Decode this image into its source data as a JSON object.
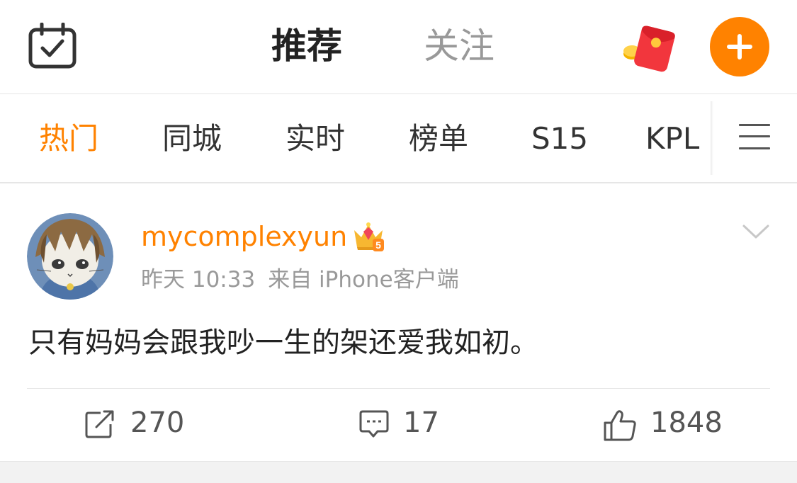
{
  "header": {
    "tabs": [
      {
        "label": "推荐",
        "active": true
      },
      {
        "label": "关注",
        "active": false
      }
    ],
    "icons": [
      "calendar-check-icon",
      "red-packet-icon",
      "plus-icon"
    ],
    "accent_color": "#FF8200",
    "underline_color": "#FFB300"
  },
  "channels": {
    "items": [
      {
        "label": "热门",
        "active": true
      },
      {
        "label": "同城",
        "active": false
      },
      {
        "label": "实时",
        "active": false
      },
      {
        "label": "榜单",
        "active": false
      },
      {
        "label": "S15",
        "active": false
      },
      {
        "label": "KPL",
        "active": false
      }
    ],
    "menu_icon": "menu-icon"
  },
  "post": {
    "username": "mycomplexyun",
    "badge_icon": "vip-crown-icon",
    "badge_level": "5",
    "date": "昨天 10:33",
    "source": "来自 iPhone客户端",
    "content": "只有妈妈会跟我吵一生的架还爱我如初。",
    "actions": {
      "repost": "270",
      "comment": "17",
      "like": "1848"
    }
  }
}
